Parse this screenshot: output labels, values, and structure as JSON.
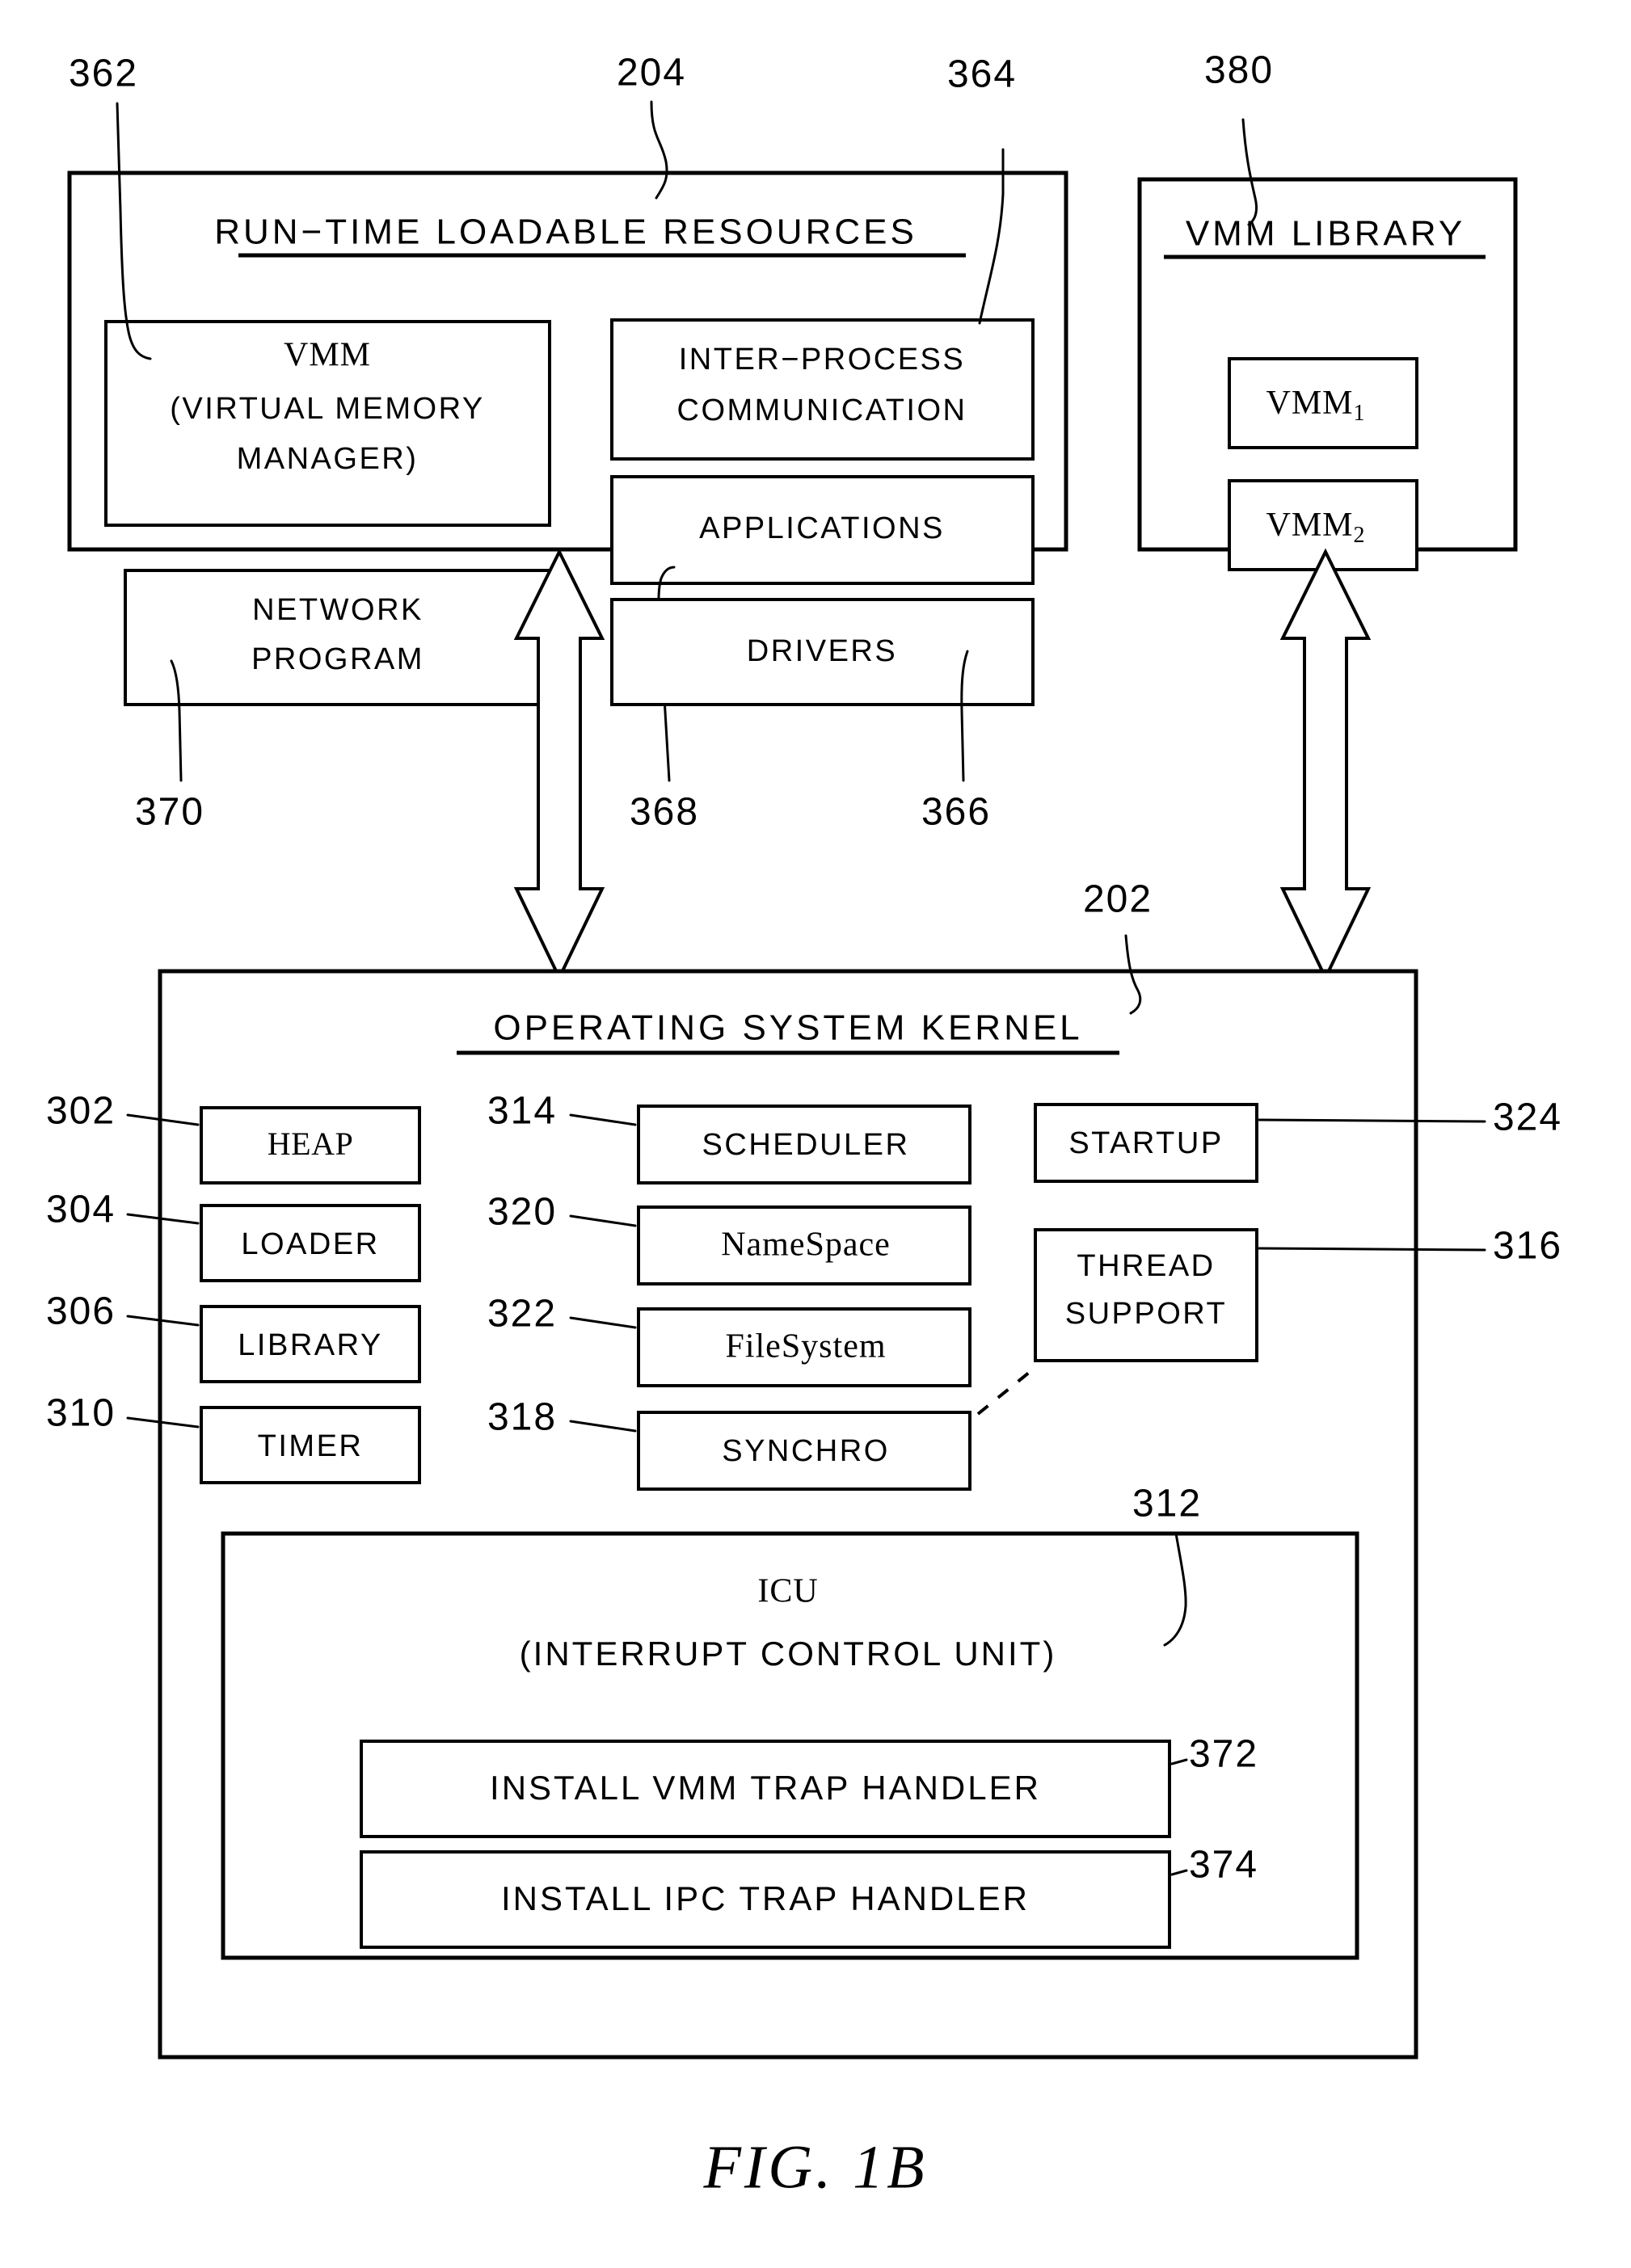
{
  "figure": {
    "caption": "FIG.  1B"
  },
  "panels": {
    "runtime": {
      "title": "RUN−TIME  LOADABLE  RESOURCES",
      "ref": "204",
      "boxes": [
        {
          "id": "vmm",
          "lines": [
            "VMM",
            "(VIRTUAL  MEMORY",
            "MANAGER)"
          ],
          "ref": "362"
        },
        {
          "id": "network",
          "lines": [
            "NETWORK",
            "PROGRAM"
          ],
          "ref": "370"
        },
        {
          "id": "ipc",
          "lines": [
            "INTER−PROCESS",
            "COMMUNICATION"
          ],
          "ref": "364"
        },
        {
          "id": "apps",
          "lines": [
            "APPLICATIONS"
          ],
          "ref": "368"
        },
        {
          "id": "drivers",
          "lines": [
            "DRIVERS"
          ],
          "ref": "366"
        }
      ]
    },
    "vmmlib": {
      "title": "VMM  LIBRARY",
      "ref": "380",
      "items": [
        {
          "id": "vmm1",
          "label": "VMM",
          "subscript": "1"
        },
        {
          "id": "vmm2",
          "label": "VMM",
          "subscript": "2"
        }
      ],
      "ellipsis": "•••"
    },
    "kernel": {
      "title": "OPERATING  SYSTEM  KERNEL",
      "ref": "202",
      "column_left": [
        {
          "id": "heap",
          "label": "HEAP",
          "ref": "302"
        },
        {
          "id": "loader",
          "label": "LOADER",
          "ref": "304"
        },
        {
          "id": "library",
          "label": "LIBRARY",
          "ref": "306"
        },
        {
          "id": "timer",
          "label": "TIMER",
          "ref": "310"
        }
      ],
      "column_mid": [
        {
          "id": "scheduler",
          "label": "SCHEDULER",
          "ref": "314",
          "serif": false
        },
        {
          "id": "namespace",
          "label": "NameSpace",
          "ref": "320",
          "serif": true
        },
        {
          "id": "filesystem",
          "label": "FileSystem",
          "ref": "322",
          "serif": true
        },
        {
          "id": "synchro",
          "label": "SYNCHRO",
          "ref": "318",
          "serif": false
        }
      ],
      "column_right": [
        {
          "id": "startup",
          "lines": [
            "STARTUP"
          ],
          "ref": "324"
        },
        {
          "id": "thread",
          "lines": [
            "THREAD",
            "SUPPORT"
          ],
          "ref": "316"
        }
      ],
      "icu": {
        "ref": "312",
        "lines": [
          "ICU",
          "(INTERRUPT  CONTROL  UNIT)"
        ],
        "handlers": [
          {
            "id": "vmm-trap",
            "label": "INSTALL  VMM  TRAP  HANDLER",
            "ref": "372"
          },
          {
            "id": "ipc-trap",
            "label": "INSTALL  IPC  TRAP  HANDLER",
            "ref": "374"
          }
        ]
      }
    }
  },
  "connectors": [
    {
      "id": "runtime-kernel-arrow",
      "type": "double-headed-arrow"
    },
    {
      "id": "vmmlib-kernel-arrow",
      "type": "double-headed-arrow"
    },
    {
      "id": "synchro-thread-link",
      "type": "dashed-line"
    }
  ],
  "colors": {
    "ink": "#000000",
    "paper": "#ffffff"
  }
}
